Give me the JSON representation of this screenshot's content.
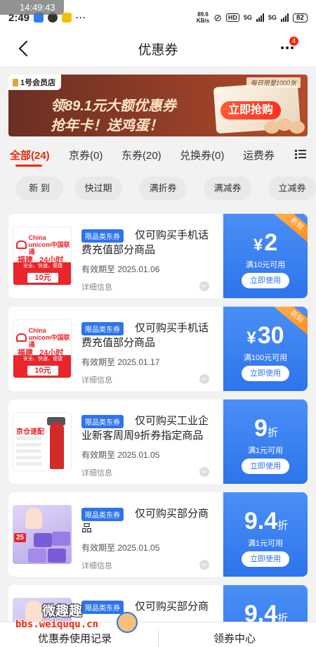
{
  "status_bar": {
    "overlay_time": "14:49:43",
    "time": "2:49",
    "speed_value": "89.6",
    "speed_unit": "KB/s",
    "hd": "HD",
    "net1": "5G",
    "net2": "5G",
    "battery": "82"
  },
  "header": {
    "title": "优惠券",
    "more_badge": "4"
  },
  "banner": {
    "brand": "1号会员店",
    "tag": "每日限量1000张",
    "line1": "领89.1元大额优惠券",
    "line2": "抢年卡！送鸡蛋！",
    "cta": "立即抢购"
  },
  "tabs": [
    {
      "label": "全部(24)",
      "active": true
    },
    {
      "label": "京券(0)"
    },
    {
      "label": "东券(20)"
    },
    {
      "label": "兑换券(0)"
    },
    {
      "label": "运费券"
    }
  ],
  "filters": [
    "新 到",
    "快过期",
    "满折券",
    "满减券",
    "立减券"
  ],
  "coupons": [
    {
      "tag": "限品类东券",
      "title": "仅可购买手机话费充值部分商品",
      "expiry": "有效期至 2025.01.06",
      "detail": "详细信息",
      "currency": "¥",
      "amount": "2",
      "unit": "",
      "condition": "满10元可用",
      "button": "立即使用",
      "new_label": "新到",
      "image": {
        "kind": "unicom",
        "logo_en1": "China",
        "logo_en2": "unicom中国联通",
        "region": "福建",
        "hours": "24小时",
        "slogan": "安全、快速、便捷",
        "price": "10元"
      }
    },
    {
      "tag": "限品类东券",
      "title": "仅可购买手机话费充值部分商品",
      "expiry": "有效期至 2025.01.17",
      "detail": "详细信息",
      "currency": "¥",
      "amount": "30",
      "unit": "",
      "condition": "满100元可用",
      "button": "立即使用",
      "new_label": "新到",
      "image": {
        "kind": "unicom",
        "logo_en1": "China",
        "logo_en2": "unicom中国联通",
        "region": "福建",
        "hours": "24小时",
        "slogan": "安全、快速、便捷",
        "price": "10元"
      }
    },
    {
      "tag": "限品类东券",
      "title": "仅可购买工业企业新客周周9折券指定商品",
      "expiry": "有效期至 2025.01.05",
      "detail": "详细信息",
      "currency": "",
      "amount": "9",
      "unit": "折",
      "condition": "满1元可用",
      "button": "立即使用",
      "new_label": "",
      "image": {
        "kind": "extinguisher",
        "caption": "京仓速配"
      }
    },
    {
      "tag": "限品类东券",
      "title": "仅可购买部分商品",
      "expiry": "有效期至 2025.01.05",
      "detail": "详细信息",
      "currency": "",
      "amount": "9.4",
      "unit": "折",
      "condition": "满1元可用",
      "button": "立即使用",
      "new_label": "",
      "image": {
        "kind": "tissue",
        "badge": "25"
      }
    },
    {
      "tag": "限品类东券",
      "title": "仅可购买部分商",
      "expiry": "",
      "detail": "",
      "currency": "",
      "amount": "9.4",
      "unit": "折",
      "condition": "",
      "button": "",
      "new_label": "",
      "image": {
        "kind": "tissue",
        "badge": ""
      }
    }
  ],
  "bottom_bar": {
    "left": "优惠券使用记录",
    "right": "领券中心"
  },
  "watermark": {
    "text": "微趣趣",
    "url": "bbs.weiququ.cn"
  },
  "colors": {
    "accent": "#f2270c",
    "coupon_blue": "#2e74ec",
    "new_orange": "#ff8a1f"
  }
}
